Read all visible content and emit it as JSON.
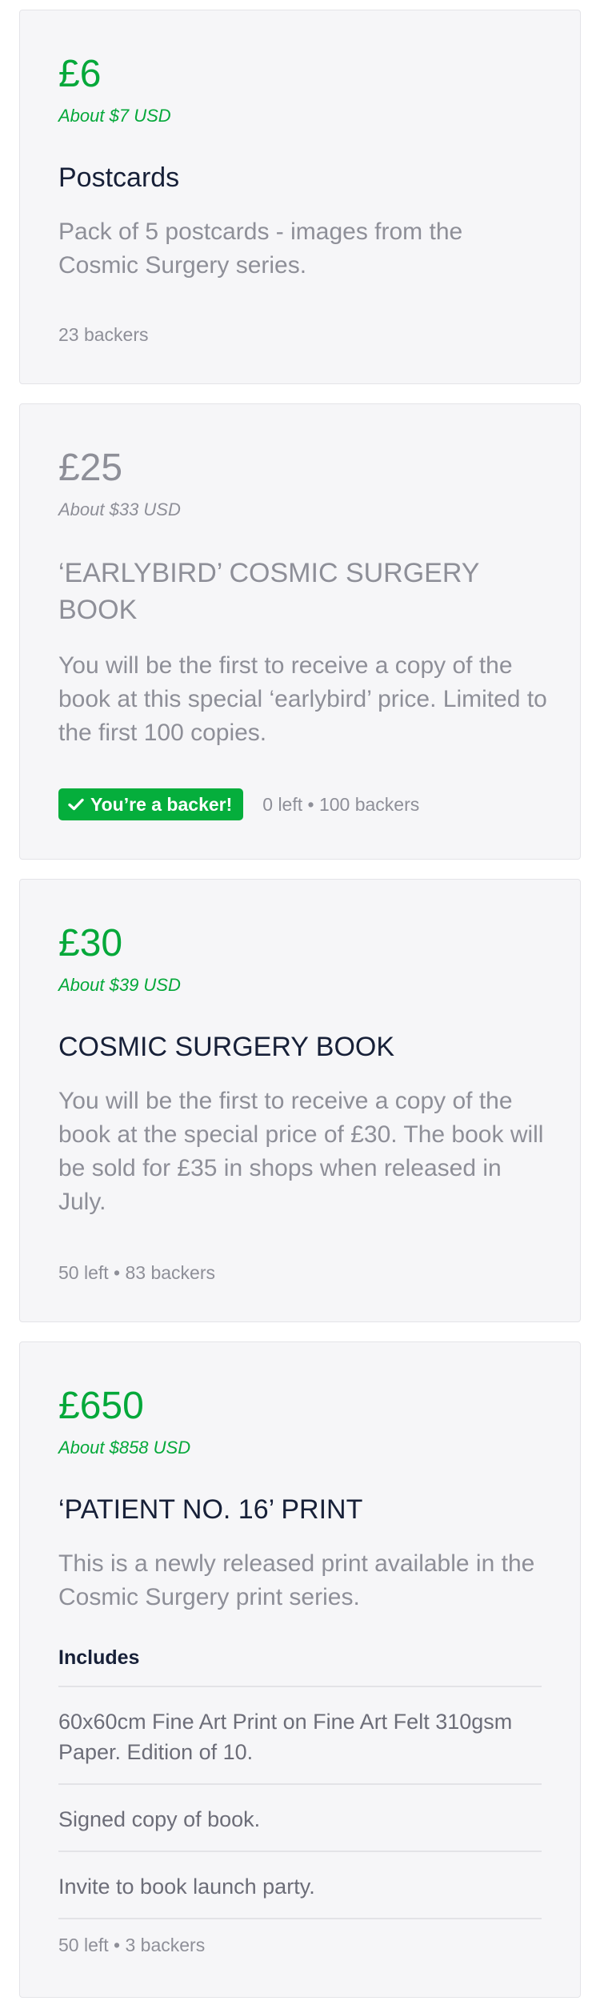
{
  "colors": {
    "accent_green": "#05a83a",
    "badge_green": "#05ae3c",
    "muted_text": "#8e8f98",
    "title_text": "#172038",
    "card_bg": "#f6f6f8"
  },
  "rewards": [
    {
      "amount": "£6",
      "converted": "About $7 USD",
      "title": "Postcards",
      "description": "Pack of 5 postcards - images from the Cosmic Surgery series.",
      "meta": "23 backers"
    },
    {
      "amount": "£25",
      "converted": "About $33 USD",
      "title": "‘EARLYBIRD’ COSMIC SURGERY BOOK",
      "description": "You will be the first to receive a copy of the book at this special ‘earlybird’ price. Limited to the first 100 copies.",
      "badge": "You’re a backer!",
      "badge_icon": "checkmark-icon",
      "meta": "0 left • 100 backers"
    },
    {
      "amount": "£30",
      "converted": "About $39 USD",
      "title": "COSMIC SURGERY BOOK",
      "description": "You will be the first to receive a copy of the book at the special price of £30. The book will be sold for £35 in shops when released in July.",
      "meta": "50 left • 83 backers"
    },
    {
      "amount": "£650",
      "converted": "About $858 USD",
      "title": "‘PATIENT NO. 16’ PRINT",
      "description": "This is a newly released print available in the Cosmic Surgery print series.",
      "includes_heading": "Includes",
      "includes": [
        "60x60cm Fine Art Print on Fine Art Felt 310gsm Paper. Edition of 10.",
        "Signed copy of book.",
        "Invite to book launch party."
      ],
      "meta": "50 left • 3 backers"
    }
  ]
}
